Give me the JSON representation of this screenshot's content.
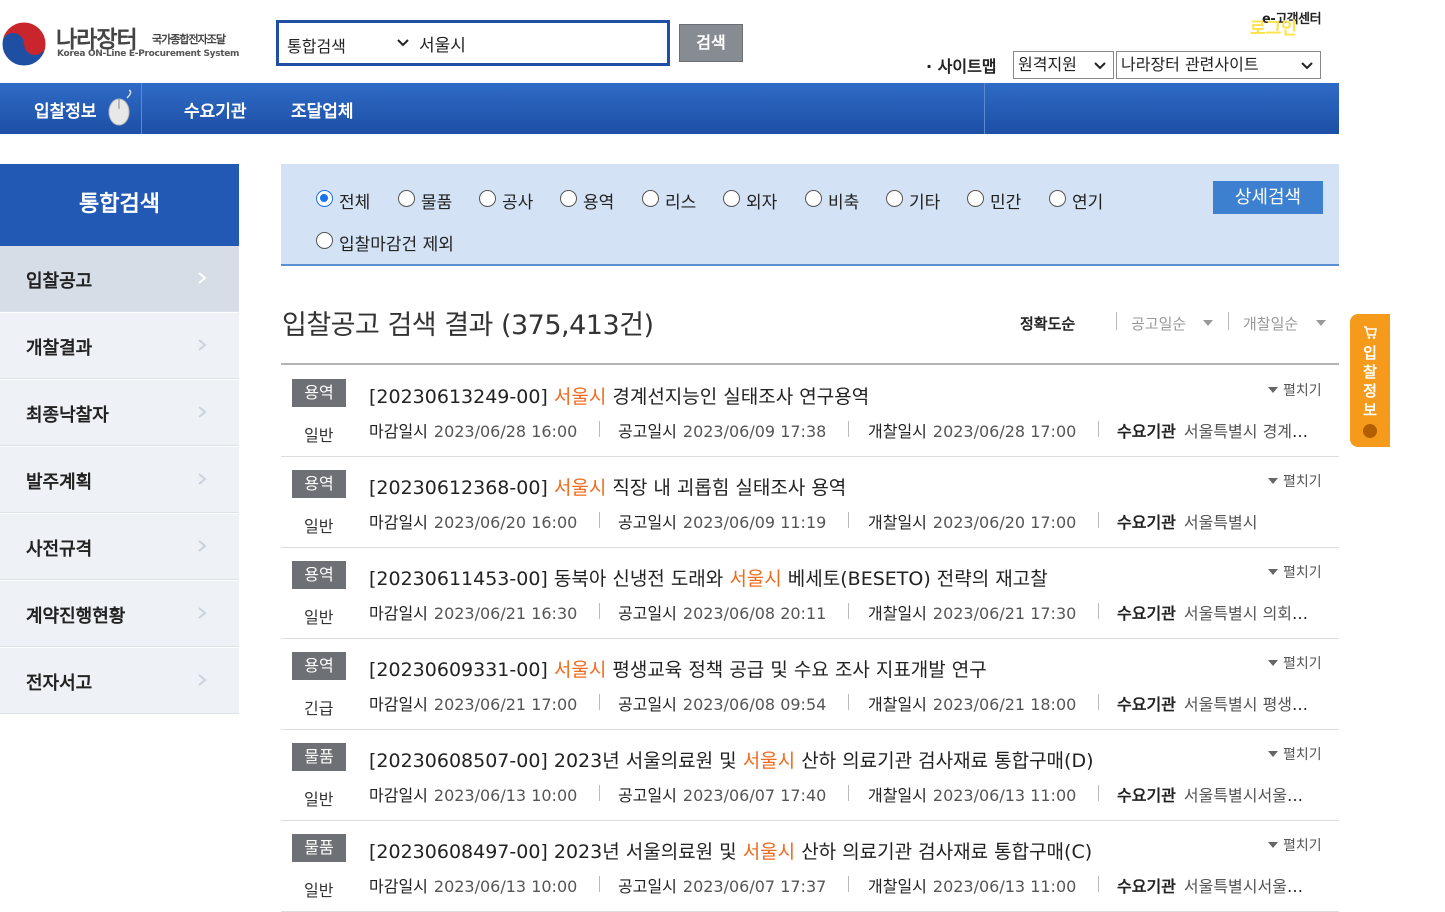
{
  "header": {
    "logo": {
      "name": "나라장터",
      "subtitle": "국가종합전자조달",
      "english": "Korea ON-Line E-Procurement System"
    },
    "search": {
      "category": "통합검색",
      "value": "서울시",
      "button_label": "검색"
    },
    "customer_center": "e-고객센터",
    "sitemap_label": "· 사이트맵",
    "select_remote": "원격지원",
    "select_related": "나라장터 관련사이트"
  },
  "nav": {
    "items": [
      "입찰정보",
      "수요기관",
      "조달업체"
    ],
    "login_label": "로그인"
  },
  "sidebar": {
    "title": "통합검색",
    "items": [
      {
        "label": "입찰공고",
        "active": true
      },
      {
        "label": "개찰결과"
      },
      {
        "label": "최종낙찰자"
      },
      {
        "label": "발주계획"
      },
      {
        "label": "사전규격"
      },
      {
        "label": "계약진행현황"
      },
      {
        "label": "전자서고"
      }
    ]
  },
  "filter": {
    "options": [
      "전체",
      "물품",
      "공사",
      "용역",
      "리스",
      "외자",
      "비축",
      "기타",
      "민간",
      "연기"
    ],
    "selected": "전체",
    "exclude_closed": "입찰마감건 제외",
    "detail_button": "상세검색"
  },
  "results": {
    "title": "입찰공고 검색 결과 (375,413건)",
    "sort": [
      "정확도순",
      "공고일순",
      "개찰일순"
    ],
    "expand_label": "펼치기",
    "labels": {
      "deadline": "마감일시",
      "notice": "공고일시",
      "opening": "개찰일시",
      "org": "수요기관"
    },
    "items": [
      {
        "category": "용역",
        "kind": "일반",
        "prefix": "[20230613249-00] ",
        "highlight": "서울시",
        "suffix": " 경계선지능인 실태조사 연구용역",
        "deadline": "2023/06/28 16:00",
        "notice": "2023/06/09 17:38",
        "opening": "2023/06/28 17:00",
        "org": "서울특별시 경계선지능인"
      },
      {
        "category": "용역",
        "kind": "일반",
        "prefix": "[20230612368-00] ",
        "highlight": "서울시",
        "suffix": " 직장 내 괴롭힘 실태조사 용역",
        "deadline": "2023/06/20 16:00",
        "notice": "2023/06/09 11:19",
        "opening": "2023/06/20 17:00",
        "org": "서울특별시"
      },
      {
        "category": "용역",
        "kind": "일반",
        "prefix": "[20230611453-00] 동북아 신냉전 도래와 ",
        "highlight": "서울시",
        "suffix": " 베세토(BESETO) 전략의 재고찰",
        "deadline": "2023/06/21 16:30",
        "notice": "2023/06/08 20:11",
        "opening": "2023/06/21 17:30",
        "org": "서울특별시 의회사무처"
      },
      {
        "category": "용역",
        "kind": "긴급",
        "prefix": "[20230609331-00] ",
        "highlight": "서울시",
        "suffix": " 평생교육 정책 공급 및 수요 조사 지표개발 연구",
        "deadline": "2023/06/21 17:00",
        "notice": "2023/06/08 09:54",
        "opening": "2023/06/21 18:00",
        "org": "서울특별시 평생교육국"
      },
      {
        "category": "물품",
        "kind": "일반",
        "prefix": "[20230608507-00] 2023년 서울의료원 및 ",
        "highlight": "서울시",
        "suffix": " 산하 의료기관 검사재료 통합구매(D)",
        "deadline": "2023/06/13 10:00",
        "notice": "2023/06/07 17:40",
        "opening": "2023/06/13 11:00",
        "org": "서울특별시서울의료원"
      },
      {
        "category": "물품",
        "kind": "일반",
        "prefix": "[20230608497-00] 2023년 서울의료원 및 ",
        "highlight": "서울시",
        "suffix": " 산하 의료기관 검사재료 통합구매(C)",
        "deadline": "2023/06/13 10:00",
        "notice": "2023/06/07 17:37",
        "opening": "2023/06/13 11:00",
        "org": "서울특별시서울의료원"
      }
    ]
  },
  "float_tab": {
    "label": "입찰정보"
  },
  "colors": {
    "primary": "#2159b5",
    "highlight": "#f26a1d",
    "login": "#ffe14a",
    "float": "#f59a1a"
  }
}
